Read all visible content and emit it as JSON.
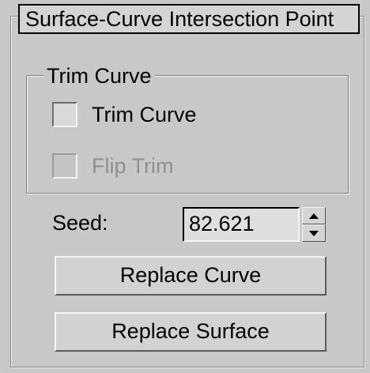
{
  "rollout": {
    "title": "Surface-Curve Intersection Point"
  },
  "trim_group": {
    "label": "Trim Curve",
    "trim_curve": {
      "label": "Trim Curve",
      "checked": false
    },
    "flip_trim": {
      "label": "Flip Trim",
      "checked": false,
      "enabled": false
    }
  },
  "seed": {
    "label": "Seed:",
    "value": "82.621"
  },
  "buttons": {
    "replace_curve": "Replace Curve",
    "replace_surface": "Replace Surface"
  },
  "icons": {
    "spinner_up": "spinner-up-icon",
    "spinner_down": "spinner-down-icon"
  }
}
